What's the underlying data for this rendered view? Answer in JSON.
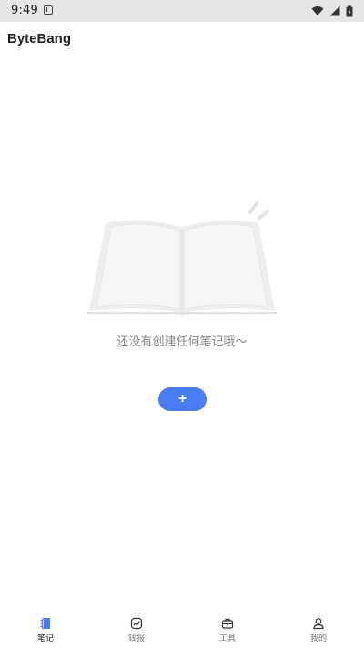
{
  "status_bar": {
    "time": "9:49"
  },
  "app": {
    "title": "ByteBang"
  },
  "empty_state": {
    "message": "还没有创建任何笔记哦～",
    "add_label": "+"
  },
  "bottom_nav": {
    "items": [
      {
        "label": "笔记",
        "icon": "notebook-icon",
        "active": true
      },
      {
        "label": "钱报",
        "icon": "finance-icon",
        "active": false
      },
      {
        "label": "工具",
        "icon": "toolbox-icon",
        "active": false
      },
      {
        "label": "我的",
        "icon": "profile-icon",
        "active": false
      }
    ]
  },
  "colors": {
    "accent": "#4a7df3",
    "status_bar_bg": "#e6e6e6",
    "text_muted": "#8a8a8a"
  }
}
